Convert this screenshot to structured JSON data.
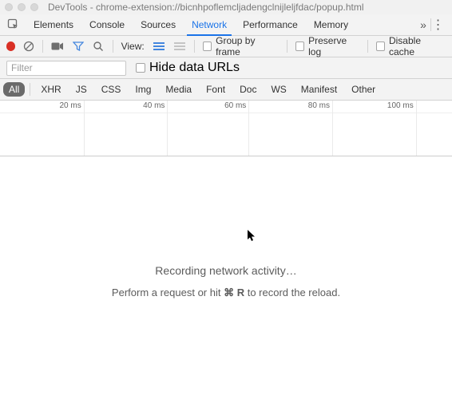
{
  "window": {
    "title": "DevTools - chrome-extension://bicnhpoflemcljadengclnijleljfdac/popup.html"
  },
  "tabs": {
    "items": [
      "Elements",
      "Console",
      "Sources",
      "Network",
      "Performance",
      "Memory"
    ],
    "active_index": 3
  },
  "toolbar": {
    "view_label": "View:",
    "group_by_frame": "Group by frame",
    "preserve_log": "Preserve log",
    "disable_cache": "Disable cache"
  },
  "filter": {
    "placeholder": "Filter",
    "hide_data_urls": "Hide data URLs"
  },
  "types": {
    "items": [
      "All",
      "XHR",
      "JS",
      "CSS",
      "Img",
      "Media",
      "Font",
      "Doc",
      "WS",
      "Manifest",
      "Other"
    ],
    "active_index": 0
  },
  "timeline": {
    "ticks": [
      "20 ms",
      "40 ms",
      "60 ms",
      "80 ms",
      "100 ms"
    ]
  },
  "empty": {
    "line1": "Recording network activity…",
    "line2_a": "Perform a request or hit ",
    "line2_key": "⌘ R",
    "line2_b": " to record the reload."
  }
}
